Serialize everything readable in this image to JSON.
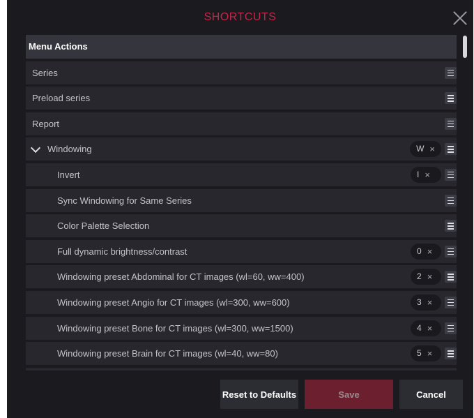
{
  "dialog": {
    "title": "SHORTCUTS",
    "accent_color": "#c8254a"
  },
  "section": {
    "header": "Menu Actions"
  },
  "rows": [
    {
      "label": "Series",
      "key": ""
    },
    {
      "label": "Preload series",
      "key": ""
    },
    {
      "label": "Report",
      "key": ""
    },
    {
      "label": "Windowing",
      "key": "W",
      "expanded": true
    },
    {
      "label": "Invert",
      "key": "I"
    },
    {
      "label": "Sync Windowing for Same Series",
      "key": ""
    },
    {
      "label": "Color Palette Selection",
      "key": ""
    },
    {
      "label": "Full dynamic brightness/contrast",
      "key": "0"
    },
    {
      "label": "Windowing preset Abdominal for CT images (wl=60, ww=400)",
      "key": "2"
    },
    {
      "label": "Windowing preset Angio for CT images (wl=300, ww=600)",
      "key": "3"
    },
    {
      "label": "Windowing preset Bone for CT images (wl=300, ww=1500)",
      "key": "4"
    },
    {
      "label": "Windowing preset Brain for CT images (wl=40, ww=80)",
      "key": "5"
    }
  ],
  "chip_remove_symbol": "×",
  "buttons": {
    "reset": "Reset to Defaults",
    "save": "Save",
    "cancel": "Cancel"
  },
  "icons": {
    "close": "close-icon",
    "row_menu": "hamburger-menu-icon",
    "expand": "chevron-down-icon"
  }
}
